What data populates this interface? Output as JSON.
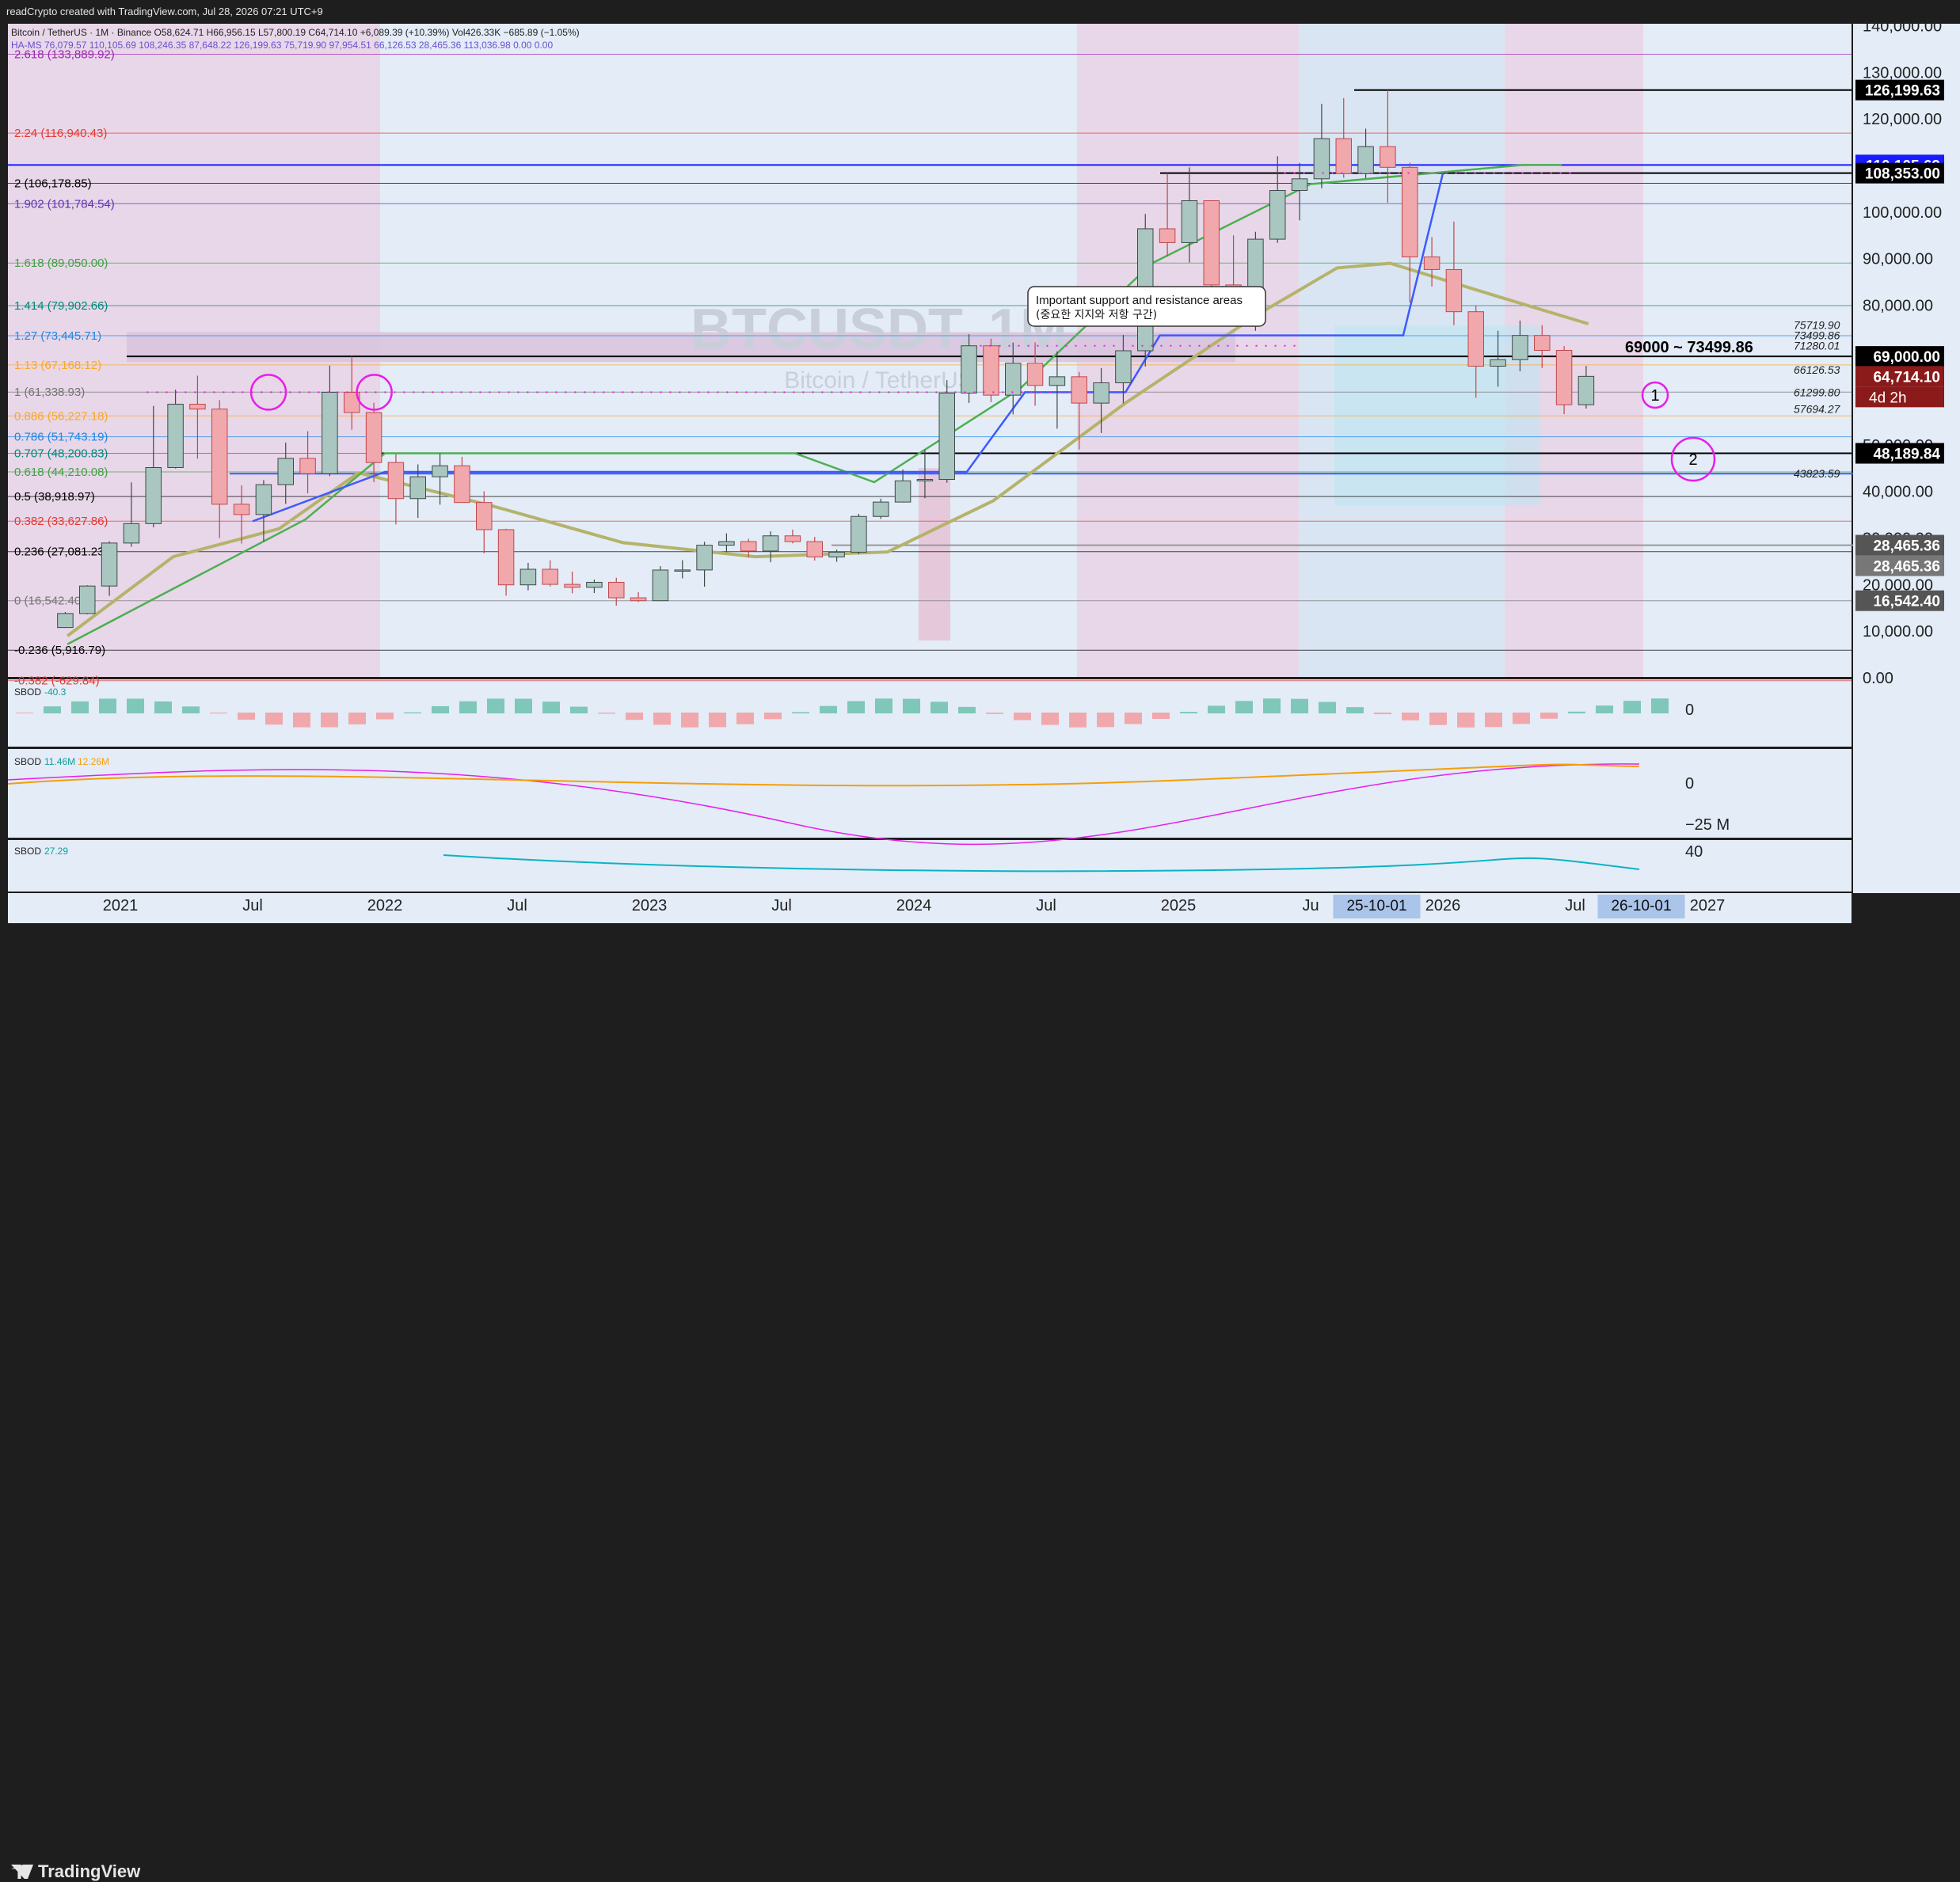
{
  "header": {
    "created": "readCrypto created with TradingView.com, Jul 28, 2026 07:21 UTC+9",
    "symbol_line": "Bitcoin / TetherUS · 1M · Binance",
    "ohlc": "O58,624.71  H66,956.15  L57,800.19  C64,714.10  +6,089.39 (+10.39%)  Vol426.33K  −685.89 (−1.05%)",
    "ha_line": "HA-MS  76,079.57  110,105.69  108,246.35  87,648.22  126,199.63  75,719.90  97,954.51  66,126.53  28,465.36  113,036.98  0.00  0.00"
  },
  "watermark": {
    "symbol": "BTCUSDT, 1M",
    "name": "Bitcoin / TetherUS"
  },
  "callout": {
    "line1": "Important support and resistance areas",
    "line2": "(중요한 지지와 저항 구간)"
  },
  "zone_label": "69000 ~ 73499.86",
  "fib_levels": [
    {
      "label": "2.618 (133,889.92)",
      "value": 133889.92,
      "color": "#9c27b0"
    },
    {
      "label": "2.24 (116,940.43)",
      "value": 116940.43,
      "color": "#e53935"
    },
    {
      "label": "2 (106,178.85)",
      "value": 106178.85,
      "color": "#000000"
    },
    {
      "label": "1.902 (101,784.54)",
      "value": 101784.54,
      "color": "#5e35b1"
    },
    {
      "label": "1.618 (89,050.00)",
      "value": 89050.0,
      "color": "#43a047"
    },
    {
      "label": "1.414 (79,902.66)",
      "value": 79902.66,
      "color": "#00897b"
    },
    {
      "label": "1.27 (73,445.71)",
      "value": 73445.71,
      "color": "#1e88e5"
    },
    {
      "label": "1.13 (67,168.12)",
      "value": 67168.12,
      "color": "#f9a825"
    },
    {
      "label": "1 (61,338.93)",
      "value": 61338.93,
      "color": "#757575"
    },
    {
      "label": "0.886 (56,227.18)",
      "value": 56227.18,
      "color": "#f9a825"
    },
    {
      "label": "0.786 (51,743.19)",
      "value": 51743.19,
      "color": "#1e88e5"
    },
    {
      "label": "0.707 (48,200.83)",
      "value": 48200.83,
      "color": "#00897b"
    },
    {
      "label": "0.618 (44,210.08)",
      "value": 44210.08,
      "color": "#43a047"
    },
    {
      "label": "0.5 (38,918.97)",
      "value": 38918.97,
      "color": "#000000"
    },
    {
      "label": "0.382 (33,627.86)",
      "value": 33627.86,
      "color": "#e53935"
    },
    {
      "label": "0.236 (27,081.23)",
      "value": 27081.23,
      "color": "#000000"
    },
    {
      "label": "0 (16,542.40)",
      "value": 16542.4,
      "color": "#757575"
    },
    {
      "label": "-0.236 (5,916.79)",
      "value": 5916.79,
      "color": "#000000"
    },
    {
      "label": "-0.382 (-629.84)",
      "value": -629.84,
      "color": "#e53935"
    }
  ],
  "right_level_labels": [
    {
      "label": "75719.90",
      "value": 75719.9
    },
    {
      "label": "73499.86",
      "value": 73499.86
    },
    {
      "label": "71280.01",
      "value": 71280.01
    },
    {
      "label": "66126.53",
      "value": 66126.53
    },
    {
      "label": "61299.80",
      "value": 61299.8
    },
    {
      "label": "57694.27",
      "value": 57694.27
    },
    {
      "label": "43823.59",
      "value": 43823.59
    }
  ],
  "price_axis": {
    "ticks": [
      "140,000.00",
      "130,000.00",
      "120,000.00",
      "110,000.00",
      "100,000.00",
      "90,000.00",
      "80,000.00",
      "70,000.00",
      "60,000.00",
      "50,000.00",
      "40,000.00",
      "30,000.00",
      "20,000.00",
      "10,000.00",
      "0.00"
    ],
    "tick_values": [
      140000,
      130000,
      120000,
      110000,
      100000,
      90000,
      80000,
      70000,
      60000,
      50000,
      40000,
      30000,
      20000,
      10000,
      0
    ],
    "badges": [
      {
        "label": "126,199.63",
        "value": 126199.63,
        "bg": "#000000",
        "fg": "#ffffff"
      },
      {
        "label": "110,105.69",
        "value": 110105.69,
        "bg": "#1a1aff",
        "fg": "#ffffff"
      },
      {
        "label": "108,353.00",
        "value": 108353.0,
        "bg": "#000000",
        "fg": "#ffffff"
      },
      {
        "label": "69,000.00",
        "value": 69000.0,
        "bg": "#000000",
        "fg": "#ffffff"
      },
      {
        "label": "64,714.10",
        "value": 64714.1,
        "bg": "#8b1a1a",
        "fg": "#ffffff"
      },
      {
        "label": "48,189.84",
        "value": 48189.84,
        "bg": "#000000",
        "fg": "#ffffff"
      },
      {
        "label": "28,465.36",
        "value": 28465.36,
        "bg": "#555555",
        "fg": "#ffffff"
      },
      {
        "label": "28,465.36",
        "value": 28465.36,
        "bg": "#777777",
        "fg": "#ffffff"
      },
      {
        "label": "16,542.40",
        "value": 16542.4,
        "bg": "#555555",
        "fg": "#ffffff"
      }
    ],
    "countdown": "4d 2h"
  },
  "time_axis": {
    "labels": [
      "2021",
      "Jul",
      "2022",
      "Jul",
      "2023",
      "Jul",
      "2024",
      "Jul",
      "2025",
      "Ju",
      "2026",
      "Jul",
      "2027"
    ],
    "highlight_left": "25-10-01",
    "highlight_right": "26-10-01"
  },
  "markers": [
    {
      "label": "1"
    },
    {
      "label": "2"
    }
  ],
  "indicators": [
    {
      "name": "SBOD",
      "values": [
        "-40.3"
      ],
      "axis": [
        "0"
      ]
    },
    {
      "name": "SBOD",
      "values": [
        "11.46M",
        "12.26M"
      ],
      "axis": [
        "0",
        "−25 M"
      ]
    },
    {
      "name": "SBOD",
      "values": [
        "27.29"
      ],
      "axis": [
        "40"
      ]
    }
  ],
  "colors": {
    "up": "#26a69a",
    "down": "#ef5350",
    "bg": "#e3ecf7",
    "magenta": "#e91ee9",
    "ma_green": "#4caf50",
    "ma_olive": "#b5b36b",
    "blue_line": "#3d5afe"
  },
  "chart_data": {
    "type": "candlestick",
    "title": "Bitcoin / TetherUS · 1M · Binance",
    "x_range": [
      "2020-10",
      "2027-03"
    ],
    "ylim": [
      -4000,
      142000
    ],
    "candles": [
      [
        "2020-10",
        10776,
        14100,
        10700,
        13791
      ],
      [
        "2020-11",
        13791,
        19863,
        13621,
        19695
      ],
      [
        "2020-12",
        19695,
        29300,
        17572,
        28923
      ],
      [
        "2021-01",
        28923,
        41950,
        28130,
        33092
      ],
      [
        "2021-02",
        33092,
        58352,
        32296,
        45137
      ],
      [
        "2021-03",
        45137,
        61844,
        44950,
        58740
      ],
      [
        "2021-04",
        58740,
        64854,
        47044,
        57694
      ],
      [
        "2021-05",
        57694,
        59600,
        30000,
        37253
      ],
      [
        "2021-06",
        37253,
        41330,
        28805,
        35045
      ],
      [
        "2021-07",
        35045,
        42448,
        29278,
        41461
      ],
      [
        "2021-08",
        41461,
        50500,
        37332,
        47100
      ],
      [
        "2021-09",
        47100,
        52920,
        39600,
        43824
      ],
      [
        "2021-10",
        43824,
        67000,
        43283,
        61299
      ],
      [
        "2021-11",
        61299,
        69000,
        53256,
        56950
      ],
      [
        "2021-12",
        56950,
        59053,
        42000,
        46216
      ],
      [
        "2022-01",
        46216,
        47990,
        32917,
        38466
      ],
      [
        "2022-02",
        38466,
        45821,
        34322,
        43160
      ],
      [
        "2022-03",
        43160,
        48189,
        37155,
        45510
      ],
      [
        "2022-04",
        45510,
        47444,
        37578,
        37630
      ],
      [
        "2022-05",
        37630,
        40023,
        26700,
        31801
      ],
      [
        "2022-06",
        31801,
        31986,
        17622,
        19942
      ],
      [
        "2022-07",
        19942,
        24668,
        18781,
        23293
      ],
      [
        "2022-08",
        23293,
        25211,
        19600,
        20050
      ],
      [
        "2022-09",
        20050,
        22799,
        18125,
        19422
      ],
      [
        "2022-10",
        19422,
        21085,
        18190,
        20491
      ],
      [
        "2022-11",
        20491,
        21480,
        15476,
        17164
      ],
      [
        "2022-12",
        17164,
        18387,
        16256,
        16542
      ],
      [
        "2023-01",
        16542,
        23960,
        16499,
        23125
      ],
      [
        "2023-02",
        23125,
        25250,
        21351,
        23141
      ],
      [
        "2023-03",
        23141,
        29184,
        19549,
        28465
      ],
      [
        "2023-04",
        28465,
        30999,
        26942,
        29233
      ],
      [
        "2023-05",
        29233,
        29820,
        25811,
        27210
      ],
      [
        "2023-06",
        27210,
        31431,
        24800,
        30472
      ],
      [
        "2023-07",
        30472,
        31804,
        28861,
        29232
      ],
      [
        "2023-08",
        29232,
        30244,
        25166,
        25940
      ],
      [
        "2023-09",
        25940,
        27483,
        24901,
        26962
      ],
      [
        "2023-10",
        26962,
        35198,
        26538,
        34640
      ],
      [
        "2023-11",
        34640,
        38450,
        34097,
        37723
      ],
      [
        "2023-12",
        37723,
        44729,
        37629,
        42283
      ],
      [
        "2024-01",
        42283,
        48969,
        38555,
        42580
      ],
      [
        "2024-02",
        42580,
        63913,
        41884,
        61130
      ],
      [
        "2024-03",
        61130,
        73777,
        59005,
        71280
      ],
      [
        "2024-04",
        71280,
        72797,
        59191,
        60672
      ],
      [
        "2024-05",
        60672,
        71979,
        56552,
        67540
      ],
      [
        "2024-06",
        67540,
        71997,
        58402,
        62772
      ],
      [
        "2024-07",
        62772,
        70079,
        53485,
        64628
      ],
      [
        "2024-08",
        64628,
        65659,
        49000,
        58974
      ],
      [
        "2024-09",
        58974,
        66498,
        52550,
        63328
      ],
      [
        "2024-10",
        63328,
        73620,
        58946,
        70215
      ],
      [
        "2024-11",
        70215,
        99588,
        66835,
        96407
      ],
      [
        "2024-12",
        96407,
        108353,
        90500,
        93429
      ],
      [
        "2025-01",
        93429,
        109588,
        89164,
        102430
      ],
      [
        "2025-02",
        102430,
        102500,
        78258,
        84350
      ],
      [
        "2025-03",
        84350,
        95000,
        76606,
        82550
      ],
      [
        "2025-04",
        82550,
        95758,
        74508,
        94172
      ],
      [
        "2025-05",
        94172,
        111980,
        93377,
        104638
      ],
      [
        "2025-06",
        104638,
        110530,
        98200,
        107135
      ],
      [
        "2025-07",
        107135,
        123218,
        105100,
        115764
      ],
      [
        "2025-08",
        115764,
        124474,
        107350,
        108246
      ],
      [
        "2025-09",
        108246,
        117900,
        107255,
        114048
      ],
      [
        "2025-10",
        114048,
        126199,
        102000,
        109600
      ],
      [
        "2025-11",
        109600,
        110600,
        80600,
        90360
      ],
      [
        "2025-12",
        90360,
        94600,
        84000,
        87648
      ],
      [
        "2026-01",
        87648,
        97954,
        75719,
        78600
      ],
      [
        "2026-02",
        78600,
        80000,
        60100,
        66900
      ],
      [
        "2026-03",
        66900,
        74500,
        62500,
        68300
      ],
      [
        "2026-04",
        68300,
        76700,
        65800,
        73499
      ],
      [
        "2026-05",
        73499,
        75700,
        66500,
        70300
      ],
      [
        "2026-06",
        70300,
        71200,
        56600,
        58624
      ],
      [
        "2026-07",
        58624,
        66956,
        57800,
        64714
      ]
    ],
    "ma_green": [
      [
        2020.8,
        7200
      ],
      [
        2021.7,
        34000
      ],
      [
        2022.0,
        48200
      ],
      [
        2023.55,
        48200
      ],
      [
        2023.85,
        42000
      ],
      [
        2024.4,
        62000
      ],
      [
        2024.9,
        89000
      ],
      [
        2025.5,
        106000
      ],
      [
        2026.3,
        110105
      ],
      [
        2026.45,
        110105
      ]
    ],
    "ma_olive": [
      [
        2020.8,
        9000
      ],
      [
        2021.2,
        26000
      ],
      [
        2021.6,
        32000
      ],
      [
        2021.9,
        44000
      ],
      [
        2022.4,
        37000
      ],
      [
        2022.9,
        29000
      ],
      [
        2023.4,
        26000
      ],
      [
        2023.9,
        27000
      ],
      [
        2024.3,
        38000
      ],
      [
        2024.8,
        59000
      ],
      [
        2025.3,
        78000
      ],
      [
        2025.6,
        88000
      ],
      [
        2025.8,
        89000
      ],
      [
        2026.2,
        82000
      ],
      [
        2026.55,
        76000
      ]
    ],
    "annotations": [
      "Important support and resistance areas",
      "69000 ~ 73499.86"
    ]
  }
}
